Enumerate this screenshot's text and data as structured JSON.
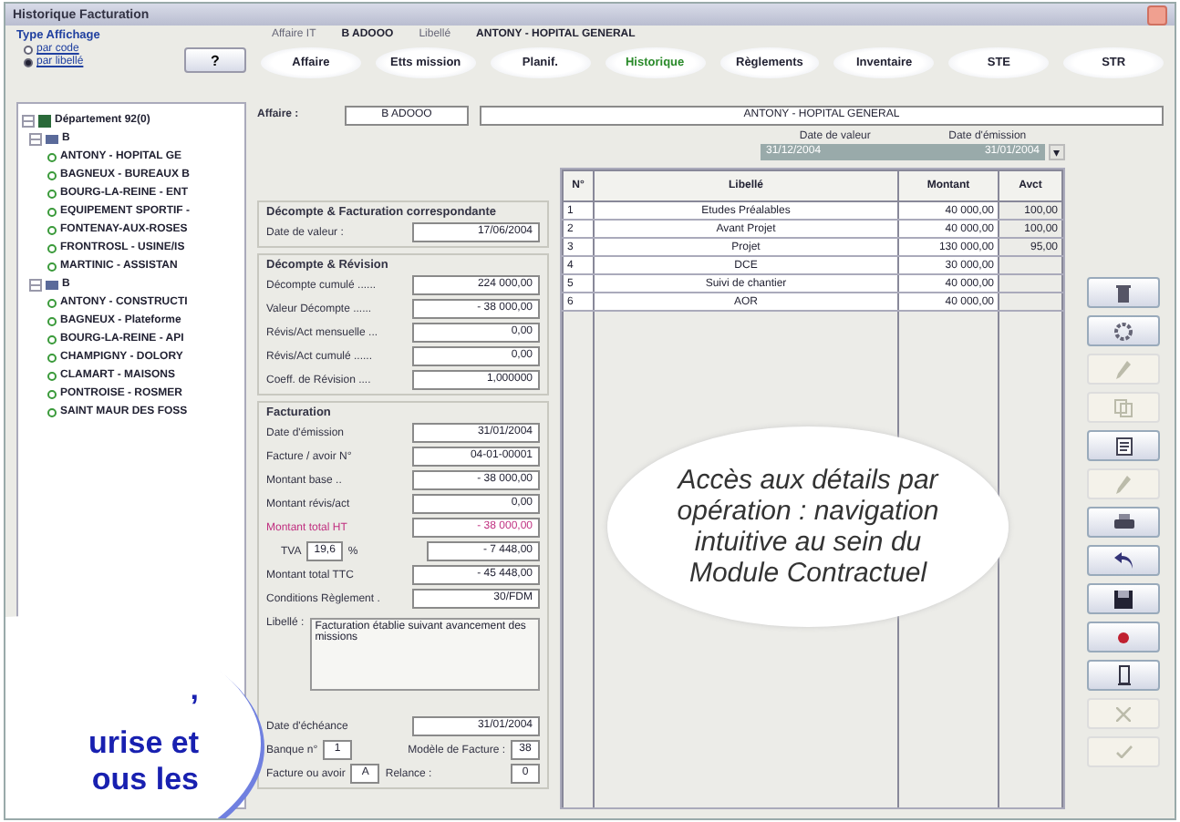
{
  "window": {
    "title": "Historique Facturation"
  },
  "display_type": {
    "title": "Type Affichage",
    "options": [
      {
        "label": "par code",
        "selected": false
      },
      {
        "label": "par libellé",
        "selected": true
      }
    ]
  },
  "help_button": {
    "label": "?"
  },
  "header": {
    "affaire_label": "Affaire IT",
    "affaire_value": "B ADOOO",
    "libelle_label": "Libellé",
    "libelle_value": "ANTONY - HOPITAL GENERAL"
  },
  "tabs": [
    {
      "label": "Affaire",
      "selected": false
    },
    {
      "label": "Etts mission",
      "selected": false
    },
    {
      "label": "Planif.",
      "selected": false
    },
    {
      "label": "Historique",
      "selected": true
    },
    {
      "label": "Règlements",
      "selected": false
    },
    {
      "label": "Inventaire",
      "selected": false
    },
    {
      "label": "STE",
      "selected": false
    },
    {
      "label": "STR",
      "selected": false
    }
  ],
  "tree": {
    "label": "Département 92(0)",
    "expanded": true,
    "children": [
      {
        "label": "B",
        "expanded": true,
        "children": [
          {
            "label": "ANTONY - HOPITAL GE"
          },
          {
            "label": "BAGNEUX - BUREAUX B"
          },
          {
            "label": "BOURG-LA-REINE - ENT"
          },
          {
            "label": "EQUIPEMENT SPORTIF -"
          },
          {
            "label": "FONTENAY-AUX-ROSES"
          },
          {
            "label": "FRONTROSL - USINE/IS"
          },
          {
            "label": "MARTINIC - ASSISTAN"
          }
        ]
      },
      {
        "label": "B",
        "expanded": true,
        "children": [
          {
            "label": "ANTONY - CONSTRUCTI"
          },
          {
            "label": "BAGNEUX - Plateforme"
          },
          {
            "label": "BOURG-LA-REINE - API"
          },
          {
            "label": "CHAMPIGNY - DOLORY"
          },
          {
            "label": "CLAMART - MAISONS"
          },
          {
            "label": "PONTROISE - ROSMER"
          },
          {
            "label": "SAINT MAUR DES FOSS"
          }
        ]
      }
    ]
  },
  "affaire": {
    "label": "Affaire :",
    "code": "B ADOOO",
    "name": "ANTONY - HOPITAL GENERAL"
  },
  "dates_selector": {
    "col1": "Date de valeur",
    "col2": "Date d'émission",
    "value1": "31/12/2004",
    "value2": "31/01/2004",
    "arrow": "▾"
  },
  "section_correspondante": {
    "title": "Décompte & Facturation correspondante",
    "fields": [
      {
        "label": "Date de valeur :",
        "value": "17/06/2004"
      }
    ]
  },
  "section_revision": {
    "title": "Décompte & Révision",
    "fields": [
      {
        "label": "Décompte cumulé ......",
        "value": "224 000,00"
      },
      {
        "label": "Valeur Décompte ......",
        "value": "- 38 000,00"
      },
      {
        "label": "Révis/Act mensuelle ...",
        "value": "0,00"
      },
      {
        "label": "Révis/Act cumulé ......",
        "value": "0,00"
      },
      {
        "label": "Coeff. de Révision ....",
        "value": "1,000000"
      }
    ]
  },
  "section_facturation": {
    "title": "Facturation",
    "fields": [
      {
        "label": "Date d'émission",
        "value": "31/01/2004",
        "kind": "plain"
      },
      {
        "label": "Facture / avoir N°",
        "value": "04-01-00001",
        "kind": "plain"
      },
      {
        "label": "Montant base ..",
        "value": "- 38 000,00",
        "kind": "plain"
      },
      {
        "label": "Montant révis/act",
        "value": "0,00",
        "kind": "plain"
      },
      {
        "label": "Montant total HT",
        "value": "- 38 000,00",
        "kind": "highlight"
      },
      {
        "label": "TVA",
        "rate": "19,6",
        "unit": "%",
        "value": "- 7 448,00",
        "kind": "tax"
      },
      {
        "label": "Montant total TTC",
        "value": "- 45 448,00",
        "kind": "plain"
      },
      {
        "label": "Conditions Règlement .",
        "value": "30/FDM",
        "kind": "plain"
      }
    ],
    "libelle_label": "Libellé :",
    "libelle_text": "Facturation établie suivant avancement des missions",
    "echeance_label": "Date d'échéance",
    "echeance_value": "31/01/2004",
    "banque_label": "Banque n°",
    "banque_value": "1",
    "modele_label": "Modèle de Facture :",
    "modele_value": "38",
    "type_label": "Facture ou avoir",
    "type_value": "A",
    "relance_label": "Relance :",
    "relance_value": "0"
  },
  "table": {
    "columns": [
      "N°",
      "Libellé",
      "Montant",
      "Avct"
    ],
    "rows": [
      [
        "1",
        "Etudes Préalables",
        "40 000,00",
        "100,00"
      ],
      [
        "2",
        "Avant Projet",
        "40 000,00",
        "100,00"
      ],
      [
        "3",
        "Projet",
        "130 000,00",
        "95,00"
      ],
      [
        "4",
        "DCE",
        "30 000,00",
        ""
      ],
      [
        "5",
        "Suivi de chantier",
        "40 000,00",
        ""
      ],
      [
        "6",
        "AOR",
        "40 000,00",
        ""
      ]
    ]
  },
  "toolbar": [
    {
      "kind": "trash",
      "disabled": false
    },
    {
      "kind": "gear",
      "disabled": false
    },
    {
      "kind": "pen",
      "disabled": true
    },
    {
      "kind": "copy",
      "disabled": true
    },
    {
      "kind": "document",
      "disabled": false
    },
    {
      "kind": "pen",
      "disabled": true
    },
    {
      "kind": "printer",
      "disabled": false
    },
    {
      "kind": "undo",
      "disabled": false
    },
    {
      "kind": "save",
      "disabled": false
    },
    {
      "kind": "dot",
      "disabled": false
    },
    {
      "kind": "door",
      "disabled": false
    },
    {
      "kind": "cross",
      "disabled": true
    },
    {
      "kind": "check",
      "disabled": true
    }
  ],
  "callouts": [
    {
      "kind": "center",
      "text": "Accès aux détails par opération : navigation intuitive au sein du Module Contractuel"
    },
    {
      "kind": "corner",
      "lines": [
        "’",
        "urise et",
        "ous les"
      ]
    }
  ]
}
